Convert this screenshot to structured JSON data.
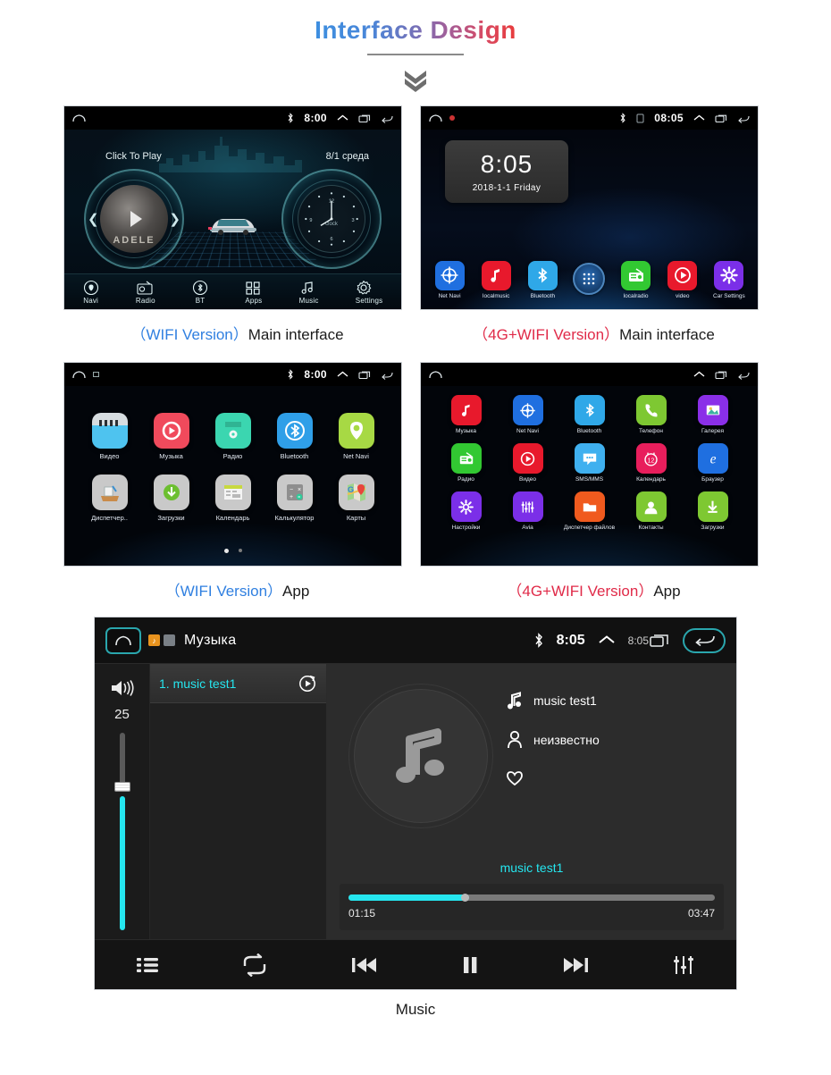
{
  "page": {
    "title": "Interface Design",
    "chevron_icon": "chevron-double-down-icon"
  },
  "panels": [
    {
      "id": "wifi-main",
      "caption_version": "（WIFI Version）",
      "caption_rest": "Main interface",
      "statusbar": {
        "time": "8:00",
        "bluetooth": "bluetooth-icon",
        "home": "home-icon",
        "up": "chevron-up-icon",
        "recent": "recent-apps-icon",
        "back": "back-icon"
      },
      "left_label": "Click To Play",
      "right_label": "8/1 среда",
      "album_text": "ADELE",
      "clock_word": "clock",
      "nav": [
        {
          "label": "Navi",
          "icon": "location-pin-icon"
        },
        {
          "label": "Radio",
          "icon": "radio-icon"
        },
        {
          "label": "BT",
          "icon": "bluetooth-icon"
        },
        {
          "label": "Apps",
          "icon": "grid-apps-icon"
        },
        {
          "label": "Music",
          "icon": "music-note-icon"
        },
        {
          "label": "Settings",
          "icon": "gear-icon"
        }
      ]
    },
    {
      "id": "4g-main",
      "caption_version": "（4G+WIFI Version）",
      "caption_rest": "Main interface",
      "statusbar": {
        "time": "08:05",
        "bluetooth": "bluetooth-icon",
        "sim": "sim-card-icon"
      },
      "clock_time": "8:05",
      "clock_date": "2018-1-1  Friday",
      "dock": [
        {
          "label": "Net Navi",
          "icon": "compass-icon",
          "color": "#1f6fe0"
        },
        {
          "label": "localmusic",
          "icon": "music-note-icon",
          "color": "#e8192c"
        },
        {
          "label": "Bluetooth",
          "icon": "bluetooth-icon",
          "color": "#2fa8e8"
        },
        {
          "label": "",
          "icon": "app-drawer-icon",
          "color": "#123a66"
        },
        {
          "label": "localradio",
          "icon": "radio-icon",
          "color": "#32c832"
        },
        {
          "label": "video",
          "icon": "play-circle-icon",
          "color": "#e8192c"
        },
        {
          "label": "Car Settings",
          "icon": "gear-icon",
          "color": "#7b2fe8"
        }
      ]
    }
  ],
  "app_wifi": {
    "caption_version": "（WIFI Version）",
    "caption_rest": "App",
    "statusbar": {
      "time": "8:00"
    },
    "rows": [
      [
        {
          "label": "Видео",
          "icon": "clapperboard-icon",
          "color": "#4ec3ef"
        },
        {
          "label": "Музыка",
          "icon": "music-play-icon",
          "color": "#f04a5c"
        },
        {
          "label": "Радио",
          "icon": "radio-icon",
          "color": "#3bd6b0"
        },
        {
          "label": "Bluetooth",
          "icon": "bluetooth-icon",
          "color": "#2f9fe8"
        },
        {
          "label": "Net Navi",
          "icon": "location-pin-icon",
          "color": "#a7d944"
        }
      ],
      [
        {
          "label": "Диспетчер..",
          "icon": "file-manager-icon",
          "color": "#c9c9c9"
        },
        {
          "label": "Загрузки",
          "icon": "download-icon",
          "color": "#c9c9c9"
        },
        {
          "label": "Календарь",
          "icon": "calendar-icon",
          "color": "#c9c9c9"
        },
        {
          "label": "Калькулятор",
          "icon": "calculator-icon",
          "color": "#c9c9c9"
        },
        {
          "label": "Карты",
          "icon": "maps-icon",
          "color": "#c9c9c9"
        }
      ]
    ],
    "page_dots": 2
  },
  "app_4g": {
    "caption_version": "（4G+WIFI Version）",
    "caption_rest": "App",
    "rows": [
      [
        {
          "label": "Музыка",
          "icon": "music-note-icon",
          "color": "#e8192c"
        },
        {
          "label": "Net Navi",
          "icon": "compass-icon",
          "color": "#1f6fe0"
        },
        {
          "label": "Bluetooth",
          "icon": "bluetooth-icon",
          "color": "#2fa8e8"
        },
        {
          "label": "Телефон",
          "icon": "phone-icon",
          "color": "#7ec832"
        },
        {
          "label": "Галерея",
          "icon": "gallery-icon",
          "color": "#8a2fe8"
        }
      ],
      [
        {
          "label": "Радио",
          "icon": "radio-icon",
          "color": "#32c832"
        },
        {
          "label": "Видео",
          "icon": "play-circle-icon",
          "color": "#e8192c"
        },
        {
          "label": "SMS/MMS",
          "icon": "message-icon",
          "color": "#3fb0ef"
        },
        {
          "label": "Календарь",
          "icon": "calendar-icon",
          "color": "#e81e5c"
        },
        {
          "label": "Браузер",
          "icon": "browser-e-icon",
          "color": "#1f6fe0"
        }
      ],
      [
        {
          "label": "Настройки",
          "icon": "gear-icon",
          "color": "#7b2fe8"
        },
        {
          "label": "Avia",
          "icon": "equalizer-icon",
          "color": "#7b2fe8"
        },
        {
          "label": "Диспетчер файлов",
          "icon": "folder-icon",
          "color": "#f05a1e"
        },
        {
          "label": "Контакты",
          "icon": "contacts-icon",
          "color": "#7ec832"
        },
        {
          "label": "Загрузки",
          "icon": "download-icon",
          "color": "#7ec832"
        }
      ]
    ]
  },
  "music": {
    "caption": "Music",
    "header": {
      "title": "Музыка",
      "time": "8:05",
      "time_secondary": "8:05",
      "home_icon": "home-icon",
      "back_icon": "back-icon",
      "bluetooth_icon": "bluetooth-icon",
      "up_icon": "chevron-up-icon",
      "recent_icon": "recent-apps-icon"
    },
    "volume": {
      "value": "25",
      "icon": "volume-icon"
    },
    "playlist": [
      {
        "name": "1. music test1",
        "action_icon": "play-history-icon"
      }
    ],
    "track": {
      "title": "music test1",
      "artist": "неизвестно",
      "title_icon": "music-note-icon",
      "artist_icon": "person-icon",
      "favorite_icon": "heart-icon",
      "now_playing": "music test1",
      "elapsed": "01:15",
      "duration": "03:47",
      "progress_percent": 33
    },
    "controls": [
      {
        "name": "playlist-button",
        "icon": "list-icon"
      },
      {
        "name": "repeat-button",
        "icon": "repeat-icon"
      },
      {
        "name": "previous-button",
        "icon": "previous-icon"
      },
      {
        "name": "pause-button",
        "icon": "pause-icon"
      },
      {
        "name": "next-button",
        "icon": "next-icon"
      },
      {
        "name": "equalizer-button",
        "icon": "equalizer-icon"
      }
    ]
  },
  "colors": {
    "accent_cyan": "#25e6ef",
    "wifi_blue": "#2f7fe0",
    "fourg_red": "#e02a48"
  }
}
